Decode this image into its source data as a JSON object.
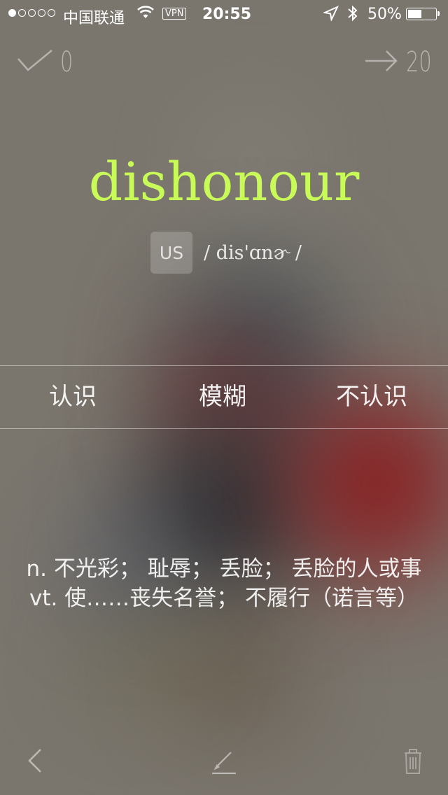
{
  "status_bar": {
    "carrier": "中国联通",
    "vpn": "VPN",
    "time": "20:55",
    "battery_percent": "50%",
    "battery_level": 0.5
  },
  "counters": {
    "known_count": "0",
    "remaining_count": "20"
  },
  "word": {
    "text": "dishonour",
    "accent_label": "US",
    "phonetic": "/ dis'ɑnɚ /",
    "color": "#c8fa58"
  },
  "choices": {
    "know": "认识",
    "fuzzy": "模糊",
    "unknown": "不认识"
  },
  "definitions": [
    "n. 不光彩； 耻辱； 丢脸； 丢脸的人或事",
    "vt. 使……丧失名誉； 不履行（诺言等）"
  ],
  "icons": {
    "check": "check-icon",
    "arrow": "arrow-right-icon",
    "back": "chevron-left-icon",
    "edit": "pen-icon",
    "trash": "trash-icon"
  }
}
